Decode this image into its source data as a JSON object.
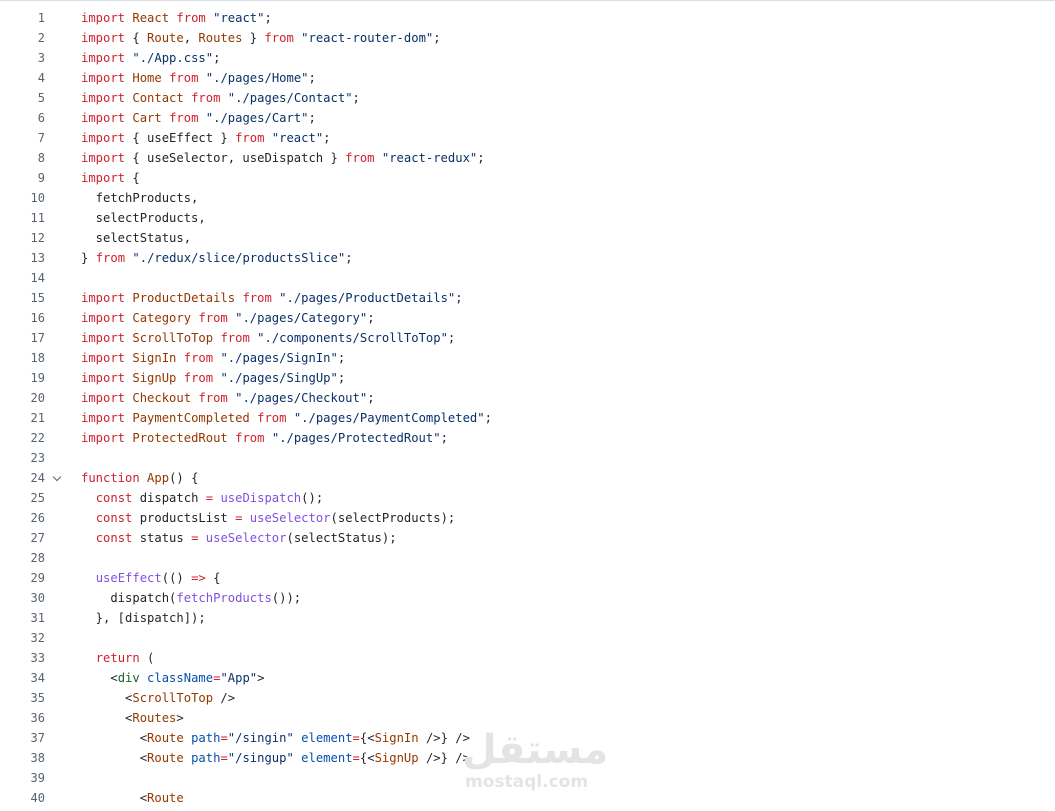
{
  "code_lines": [
    {
      "n": "1",
      "tokens": [
        [
          "kw",
          "import"
        ],
        [
          "t",
          " "
        ],
        [
          "id",
          "React"
        ],
        [
          "t",
          " "
        ],
        [
          "kw",
          "from"
        ],
        [
          "t",
          " "
        ],
        [
          "str",
          "\"react\""
        ],
        [
          "t",
          ";"
        ]
      ]
    },
    {
      "n": "2",
      "tokens": [
        [
          "kw",
          "import"
        ],
        [
          "t",
          " { "
        ],
        [
          "id",
          "Route"
        ],
        [
          "t",
          ", "
        ],
        [
          "id",
          "Routes"
        ],
        [
          "t",
          " } "
        ],
        [
          "kw",
          "from"
        ],
        [
          "t",
          " "
        ],
        [
          "str",
          "\"react-router-dom\""
        ],
        [
          "t",
          ";"
        ]
      ]
    },
    {
      "n": "3",
      "tokens": [
        [
          "kw",
          "import"
        ],
        [
          "t",
          " "
        ],
        [
          "str",
          "\"./App.css\""
        ],
        [
          "t",
          ";"
        ]
      ]
    },
    {
      "n": "4",
      "tokens": [
        [
          "kw",
          "import"
        ],
        [
          "t",
          " "
        ],
        [
          "id",
          "Home"
        ],
        [
          "t",
          " "
        ],
        [
          "kw",
          "from"
        ],
        [
          "t",
          " "
        ],
        [
          "str",
          "\"./pages/Home\""
        ],
        [
          "t",
          ";"
        ]
      ]
    },
    {
      "n": "5",
      "tokens": [
        [
          "kw",
          "import"
        ],
        [
          "t",
          " "
        ],
        [
          "id",
          "Contact"
        ],
        [
          "t",
          " "
        ],
        [
          "kw",
          "from"
        ],
        [
          "t",
          " "
        ],
        [
          "str",
          "\"./pages/Contact\""
        ],
        [
          "t",
          ";"
        ]
      ]
    },
    {
      "n": "6",
      "tokens": [
        [
          "kw",
          "import"
        ],
        [
          "t",
          " "
        ],
        [
          "id",
          "Cart"
        ],
        [
          "t",
          " "
        ],
        [
          "kw",
          "from"
        ],
        [
          "t",
          " "
        ],
        [
          "str",
          "\"./pages/Cart\""
        ],
        [
          "t",
          ";"
        ]
      ]
    },
    {
      "n": "7",
      "tokens": [
        [
          "kw",
          "import"
        ],
        [
          "t",
          " { useEffect } "
        ],
        [
          "kw",
          "from"
        ],
        [
          "t",
          " "
        ],
        [
          "str",
          "\"react\""
        ],
        [
          "t",
          ";"
        ]
      ]
    },
    {
      "n": "8",
      "tokens": [
        [
          "kw",
          "import"
        ],
        [
          "t",
          " { useSelector, useDispatch } "
        ],
        [
          "kw",
          "from"
        ],
        [
          "t",
          " "
        ],
        [
          "str",
          "\"react-redux\""
        ],
        [
          "t",
          ";"
        ]
      ]
    },
    {
      "n": "9",
      "tokens": [
        [
          "kw",
          "import"
        ],
        [
          "t",
          " {"
        ]
      ]
    },
    {
      "n": "10",
      "tokens": [
        [
          "t",
          "  fetchProducts,"
        ]
      ]
    },
    {
      "n": "11",
      "tokens": [
        [
          "t",
          "  selectProducts,"
        ]
      ]
    },
    {
      "n": "12",
      "tokens": [
        [
          "t",
          "  selectStatus,"
        ]
      ]
    },
    {
      "n": "13",
      "tokens": [
        [
          "t",
          "} "
        ],
        [
          "kw",
          "from"
        ],
        [
          "t",
          " "
        ],
        [
          "str",
          "\"./redux/slice/productsSlice\""
        ],
        [
          "t",
          ";"
        ]
      ]
    },
    {
      "n": "14",
      "tokens": []
    },
    {
      "n": "15",
      "tokens": [
        [
          "kw",
          "import"
        ],
        [
          "t",
          " "
        ],
        [
          "id",
          "ProductDetails"
        ],
        [
          "t",
          " "
        ],
        [
          "kw",
          "from"
        ],
        [
          "t",
          " "
        ],
        [
          "str",
          "\"./pages/ProductDetails\""
        ],
        [
          "t",
          ";"
        ]
      ]
    },
    {
      "n": "16",
      "tokens": [
        [
          "kw",
          "import"
        ],
        [
          "t",
          " "
        ],
        [
          "id",
          "Category"
        ],
        [
          "t",
          " "
        ],
        [
          "kw",
          "from"
        ],
        [
          "t",
          " "
        ],
        [
          "str",
          "\"./pages/Category\""
        ],
        [
          "t",
          ";"
        ]
      ]
    },
    {
      "n": "17",
      "tokens": [
        [
          "kw",
          "import"
        ],
        [
          "t",
          " "
        ],
        [
          "id",
          "ScrollToTop"
        ],
        [
          "t",
          " "
        ],
        [
          "kw",
          "from"
        ],
        [
          "t",
          " "
        ],
        [
          "str",
          "\"./components/ScrollToTop\""
        ],
        [
          "t",
          ";"
        ]
      ]
    },
    {
      "n": "18",
      "tokens": [
        [
          "kw",
          "import"
        ],
        [
          "t",
          " "
        ],
        [
          "id",
          "SignIn"
        ],
        [
          "t",
          " "
        ],
        [
          "kw",
          "from"
        ],
        [
          "t",
          " "
        ],
        [
          "str",
          "\"./pages/SignIn\""
        ],
        [
          "t",
          ";"
        ]
      ]
    },
    {
      "n": "19",
      "tokens": [
        [
          "kw",
          "import"
        ],
        [
          "t",
          " "
        ],
        [
          "id",
          "SignUp"
        ],
        [
          "t",
          " "
        ],
        [
          "kw",
          "from"
        ],
        [
          "t",
          " "
        ],
        [
          "str",
          "\"./pages/SingUp\""
        ],
        [
          "t",
          ";"
        ]
      ]
    },
    {
      "n": "20",
      "tokens": [
        [
          "kw",
          "import"
        ],
        [
          "t",
          " "
        ],
        [
          "id",
          "Checkout"
        ],
        [
          "t",
          " "
        ],
        [
          "kw",
          "from"
        ],
        [
          "t",
          " "
        ],
        [
          "str",
          "\"./pages/Checkout\""
        ],
        [
          "t",
          ";"
        ]
      ]
    },
    {
      "n": "21",
      "tokens": [
        [
          "kw",
          "import"
        ],
        [
          "t",
          " "
        ],
        [
          "id",
          "PaymentCompleted"
        ],
        [
          "t",
          " "
        ],
        [
          "kw",
          "from"
        ],
        [
          "t",
          " "
        ],
        [
          "str",
          "\"./pages/PaymentCompleted\""
        ],
        [
          "t",
          ";"
        ]
      ]
    },
    {
      "n": "22",
      "tokens": [
        [
          "kw",
          "import"
        ],
        [
          "t",
          " "
        ],
        [
          "id",
          "ProtectedRout"
        ],
        [
          "t",
          " "
        ],
        [
          "kw",
          "from"
        ],
        [
          "t",
          " "
        ],
        [
          "str",
          "\"./pages/ProtectedRout\""
        ],
        [
          "t",
          ";"
        ]
      ]
    },
    {
      "n": "23",
      "tokens": []
    },
    {
      "n": "24",
      "fold": true,
      "tokens": [
        [
          "kw",
          "function"
        ],
        [
          "t",
          " "
        ],
        [
          "id",
          "App"
        ],
        [
          "t",
          "() {"
        ]
      ]
    },
    {
      "n": "25",
      "tokens": [
        [
          "t",
          "  "
        ],
        [
          "kw",
          "const"
        ],
        [
          "t",
          " dispatch "
        ],
        [
          "kw",
          "="
        ],
        [
          "t",
          " "
        ],
        [
          "fn",
          "useDispatch"
        ],
        [
          "t",
          "();"
        ]
      ]
    },
    {
      "n": "26",
      "tokens": [
        [
          "t",
          "  "
        ],
        [
          "kw",
          "const"
        ],
        [
          "t",
          " productsList "
        ],
        [
          "kw",
          "="
        ],
        [
          "t",
          " "
        ],
        [
          "fn",
          "useSelector"
        ],
        [
          "t",
          "(selectProducts);"
        ]
      ]
    },
    {
      "n": "27",
      "tokens": [
        [
          "t",
          "  "
        ],
        [
          "kw",
          "const"
        ],
        [
          "t",
          " status "
        ],
        [
          "kw",
          "="
        ],
        [
          "t",
          " "
        ],
        [
          "fn",
          "useSelector"
        ],
        [
          "t",
          "(selectStatus);"
        ]
      ]
    },
    {
      "n": "28",
      "tokens": []
    },
    {
      "n": "29",
      "tokens": [
        [
          "t",
          "  "
        ],
        [
          "fn",
          "useEffect"
        ],
        [
          "t",
          "(() "
        ],
        [
          "kw",
          "=>"
        ],
        [
          "t",
          " {"
        ]
      ]
    },
    {
      "n": "30",
      "tokens": [
        [
          "t",
          "    dispatch("
        ],
        [
          "fn",
          "fetchProducts"
        ],
        [
          "t",
          "());"
        ]
      ]
    },
    {
      "n": "31",
      "tokens": [
        [
          "t",
          "  }, [dispatch]);"
        ]
      ]
    },
    {
      "n": "32",
      "tokens": []
    },
    {
      "n": "33",
      "tokens": [
        [
          "t",
          "  "
        ],
        [
          "kw",
          "return"
        ],
        [
          "t",
          " ("
        ]
      ]
    },
    {
      "n": "34",
      "tokens": [
        [
          "t",
          "    <"
        ],
        [
          "tag",
          "div"
        ],
        [
          "t",
          " "
        ],
        [
          "attr",
          "className"
        ],
        [
          "kw",
          "="
        ],
        [
          "str",
          "\"App\""
        ],
        [
          "t",
          ">"
        ]
      ]
    },
    {
      "n": "35",
      "tokens": [
        [
          "t",
          "      <"
        ],
        [
          "id",
          "ScrollToTop"
        ],
        [
          "t",
          " />"
        ]
      ]
    },
    {
      "n": "36",
      "tokens": [
        [
          "t",
          "      <"
        ],
        [
          "id",
          "Routes"
        ],
        [
          "t",
          ">"
        ]
      ]
    },
    {
      "n": "37",
      "tokens": [
        [
          "t",
          "        <"
        ],
        [
          "id",
          "Route"
        ],
        [
          "t",
          " "
        ],
        [
          "attr",
          "path"
        ],
        [
          "kw",
          "="
        ],
        [
          "str",
          "\"/singin\""
        ],
        [
          "t",
          " "
        ],
        [
          "attr",
          "element"
        ],
        [
          "kw",
          "="
        ],
        [
          "t",
          "{<"
        ],
        [
          "id",
          "SignIn"
        ],
        [
          "t",
          " />} />"
        ]
      ]
    },
    {
      "n": "38",
      "tokens": [
        [
          "t",
          "        <"
        ],
        [
          "id",
          "Route"
        ],
        [
          "t",
          " "
        ],
        [
          "attr",
          "path"
        ],
        [
          "kw",
          "="
        ],
        [
          "str",
          "\"/singup\""
        ],
        [
          "t",
          " "
        ],
        [
          "attr",
          "element"
        ],
        [
          "kw",
          "="
        ],
        [
          "t",
          "{<"
        ],
        [
          "id",
          "SignUp"
        ],
        [
          "t",
          " />} />"
        ]
      ]
    },
    {
      "n": "39",
      "tokens": []
    },
    {
      "n": "40",
      "tokens": [
        [
          "t",
          "        <"
        ],
        [
          "id",
          "Route"
        ]
      ]
    }
  ],
  "watermark": {
    "arabic": "مستقل",
    "latin": "mostaql.com"
  }
}
